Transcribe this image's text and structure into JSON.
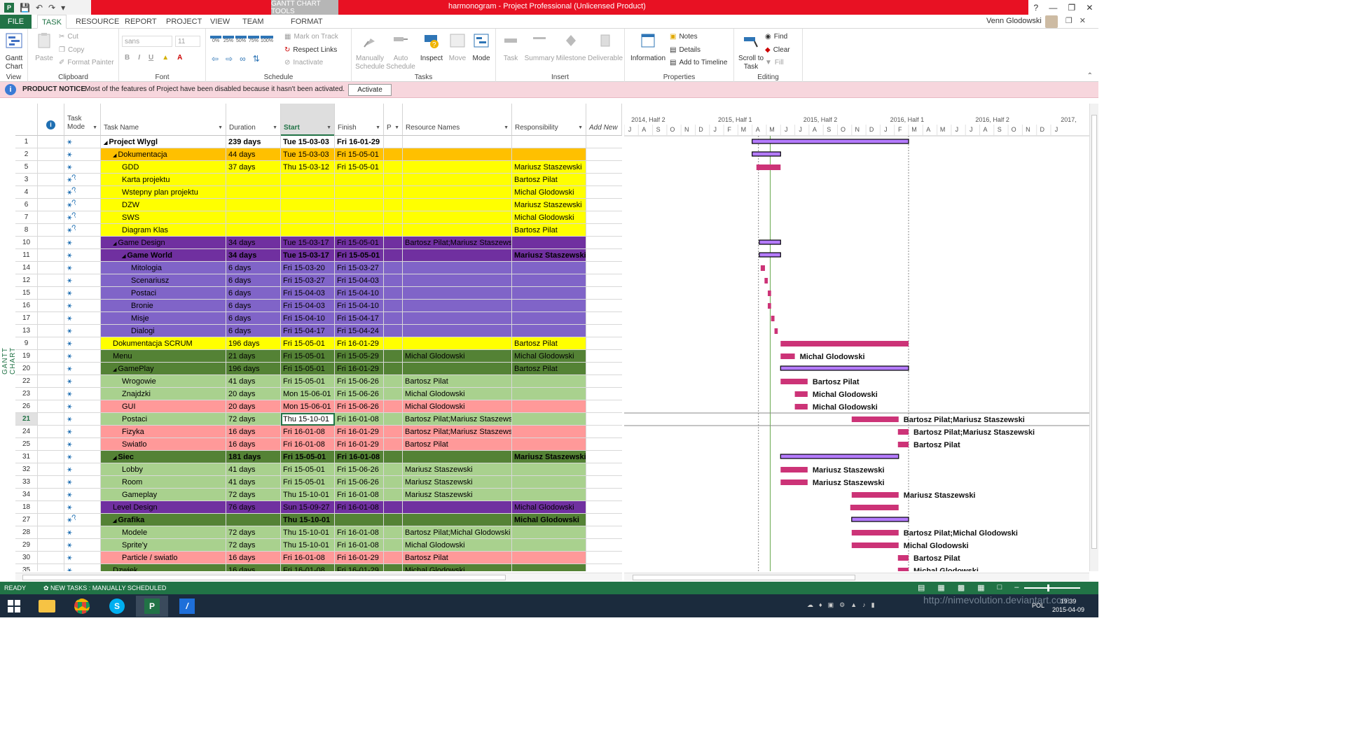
{
  "app": {
    "window_title": "harmonogram - Project Professional (Unlicensed Product)",
    "context_tab_header": "GANTT CHART TOOLS",
    "user_name": "Venn Glodowski"
  },
  "tabs": [
    "FILE",
    "TASK",
    "RESOURCE",
    "REPORT",
    "PROJECT",
    "VIEW",
    "TEAM",
    "FORMAT"
  ],
  "ribbon": {
    "view": {
      "label": "View",
      "gantt": "Gantt Chart"
    },
    "clipboard": {
      "label": "Clipboard",
      "paste": "Paste",
      "cut": "Cut",
      "copy": "Copy",
      "format_painter": "Format Painter"
    },
    "font": {
      "label": "Font",
      "family": "sans",
      "size": "11"
    },
    "schedule": {
      "label": "Schedule",
      "mark_on_track": "Mark on Track",
      "respect_links": "Respect Links",
      "inactivate": "Inactivate",
      "pct": [
        "0%",
        "25%",
        "50%",
        "75%",
        "100%"
      ]
    },
    "tasks": {
      "label": "Tasks",
      "manually": "Manually Schedule",
      "auto": "Auto Schedule",
      "inspect": "Inspect",
      "move": "Move",
      "mode": "Mode"
    },
    "insert": {
      "label": "Insert",
      "task": "Task",
      "summary": "Summary",
      "milestone": "Milestone",
      "deliverable": "Deliverable"
    },
    "properties": {
      "label": "Properties",
      "information": "Information",
      "notes": "Notes",
      "details": "Details",
      "add_to_timeline": "Add to Timeline"
    },
    "editing": {
      "label": "Editing",
      "scroll": "Scroll to Task",
      "find": "Find",
      "clear": "Clear",
      "fill": "Fill"
    }
  },
  "notice": {
    "title": "PRODUCT NOTICE",
    "text": "Most of the features of Project have been disabled because it hasn't been activated.",
    "button": "Activate"
  },
  "side_label": "GANTT CHART",
  "columns": {
    "task_mode": "Task Mode",
    "task_name": "Task Name",
    "duration": "Duration",
    "start": "Start",
    "finish": "Finish",
    "p": "P",
    "resource_names": "Resource Names",
    "responsibility": "Responsibility",
    "add_new": "Add New"
  },
  "timescale": {
    "top": [
      {
        "label": "2014, Half 2",
        "start": 0.5
      },
      {
        "label": "2015, Half 1",
        "start": 6.6
      },
      {
        "label": "2015, Half 2",
        "start": 12.6
      },
      {
        "label": "2016, Half 1",
        "start": 18.7
      },
      {
        "label": "2016, Half 2",
        "start": 24.7
      },
      {
        "label": "2017,",
        "start": 30.7
      }
    ],
    "months": [
      "J",
      "A",
      "S",
      "O",
      "N",
      "D",
      "J",
      "F",
      "M",
      "A",
      "M",
      "J",
      "J",
      "A",
      "S",
      "O",
      "N",
      "D",
      "J",
      "F",
      "M",
      "A",
      "M",
      "J",
      "J",
      "A",
      "S",
      "O",
      "N",
      "D",
      "J"
    ]
  },
  "rows": [
    {
      "id": "1",
      "mode": "manual",
      "name": "Project Wlygl",
      "dur": "239 days",
      "start": "Tue 15-03-03",
      "fin": "Fri 16-01-29",
      "res": "",
      "resp": "",
      "fill": "#ffffff",
      "text": "#000000",
      "bold": true,
      "indent": 0,
      "summary": true,
      "bar": {
        "type": "summary",
        "s": 9.0,
        "e": 20.0
      },
      "label": ""
    },
    {
      "id": "2",
      "mode": "manual",
      "name": "Dokumentacja",
      "dur": "44 days",
      "start": "Tue 15-03-03",
      "fin": "Fri 15-05-01",
      "res": "",
      "resp": "",
      "fill": "#ffc000",
      "text": "#000000",
      "bold": false,
      "indent": 1,
      "summary": true,
      "bar": {
        "type": "summary",
        "s": 9.0,
        "e": 11.0
      },
      "label": ""
    },
    {
      "id": "5",
      "mode": "manual",
      "name": "GDD",
      "dur": "37 days",
      "start": "Thu 15-03-12",
      "fin": "Fri 15-05-01",
      "res": "",
      "resp": "Mariusz Staszewski",
      "fill": "#ffff00",
      "text": "#000000",
      "bold": false,
      "indent": 2,
      "summary": false,
      "bar": {
        "type": "task",
        "s": 9.3,
        "e": 11.0
      },
      "label": ""
    },
    {
      "id": "3",
      "mode": "estimated",
      "name": "Karta projektu",
      "dur": "",
      "start": "",
      "fin": "",
      "res": "",
      "resp": "Bartosz Pilat",
      "fill": "#ffff00",
      "text": "#000000",
      "bold": false,
      "indent": 2,
      "summary": false,
      "bar": null,
      "label": ""
    },
    {
      "id": "4",
      "mode": "estimated",
      "name": "Wstepny plan projektu",
      "dur": "",
      "start": "",
      "fin": "",
      "res": "",
      "resp": "Michal Glodowski",
      "fill": "#ffff00",
      "text": "#000000",
      "bold": false,
      "indent": 2,
      "summary": false,
      "bar": null,
      "label": ""
    },
    {
      "id": "6",
      "mode": "estimated",
      "name": "DZW",
      "dur": "",
      "start": "",
      "fin": "",
      "res": "",
      "resp": "Mariusz Staszewski",
      "fill": "#ffff00",
      "text": "#000000",
      "bold": false,
      "indent": 2,
      "summary": false,
      "bar": null,
      "label": ""
    },
    {
      "id": "7",
      "mode": "estimated",
      "name": "SWS",
      "dur": "",
      "start": "",
      "fin": "",
      "res": "",
      "resp": "Michal Glodowski",
      "fill": "#ffff00",
      "text": "#000000",
      "bold": false,
      "indent": 2,
      "summary": false,
      "bar": null,
      "label": ""
    },
    {
      "id": "8",
      "mode": "estimated",
      "name": "Diagram Klas",
      "dur": "",
      "start": "",
      "fin": "",
      "res": "",
      "resp": "Bartosz Pilat",
      "fill": "#ffff00",
      "text": "#000000",
      "bold": false,
      "indent": 2,
      "summary": false,
      "bar": null,
      "label": ""
    },
    {
      "id": "10",
      "mode": "manual",
      "name": "Game Design",
      "dur": "34 days",
      "start": "Tue 15-03-17",
      "fin": "Fri 15-05-01",
      "res": "Bartosz Pilat;Mariusz Staszewski",
      "resp": "",
      "fill": "#7030a0",
      "text": "#000000",
      "bold": false,
      "indent": 1,
      "summary": true,
      "bar": {
        "type": "summary",
        "s": 9.5,
        "e": 11.0
      },
      "label": ""
    },
    {
      "id": "11",
      "mode": "manual",
      "name": "Game World",
      "dur": "34 days",
      "start": "Tue 15-03-17",
      "fin": "Fri 15-05-01",
      "res": "",
      "resp": "Mariusz Staszewski",
      "fill": "#7030a0",
      "text": "#000000",
      "bold": true,
      "indent": 2,
      "summary": true,
      "bar": {
        "type": "summary",
        "s": 9.5,
        "e": 11.0
      },
      "label": ""
    },
    {
      "id": "14",
      "mode": "manual",
      "name": "Mitologia",
      "dur": "6 days",
      "start": "Fri 15-03-20",
      "fin": "Fri 15-03-27",
      "res": "",
      "resp": "",
      "fill": "#8064c8",
      "text": "#000000",
      "bold": false,
      "indent": 3,
      "summary": false,
      "bar": {
        "type": "task",
        "s": 9.6,
        "e": 9.9
      },
      "label": ""
    },
    {
      "id": "12",
      "mode": "manual",
      "name": "Scenariusz",
      "dur": "6 days",
      "start": "Fri 15-03-27",
      "fin": "Fri 15-04-03",
      "res": "",
      "resp": "",
      "fill": "#8064c8",
      "text": "#000000",
      "bold": false,
      "indent": 3,
      "summary": false,
      "bar": {
        "type": "task",
        "s": 9.87,
        "e": 10.1
      },
      "label": ""
    },
    {
      "id": "15",
      "mode": "manual",
      "name": "Postaci",
      "dur": "6 days",
      "start": "Fri 15-04-03",
      "fin": "Fri 15-04-10",
      "res": "",
      "resp": "",
      "fill": "#8064c8",
      "text": "#000000",
      "bold": false,
      "indent": 3,
      "summary": false,
      "bar": {
        "type": "task",
        "s": 10.1,
        "e": 10.33
      },
      "label": ""
    },
    {
      "id": "16",
      "mode": "manual",
      "name": "Bronie",
      "dur": "6 days",
      "start": "Fri 15-04-03",
      "fin": "Fri 15-04-10",
      "res": "",
      "resp": "",
      "fill": "#8064c8",
      "text": "#000000",
      "bold": false,
      "indent": 3,
      "summary": false,
      "bar": {
        "type": "task",
        "s": 10.1,
        "e": 10.33
      },
      "label": ""
    },
    {
      "id": "17",
      "mode": "manual",
      "name": "Misje",
      "dur": "6 days",
      "start": "Fri 15-04-10",
      "fin": "Fri 15-04-17",
      "res": "",
      "resp": "",
      "fill": "#8064c8",
      "text": "#000000",
      "bold": false,
      "indent": 3,
      "summary": false,
      "bar": {
        "type": "task",
        "s": 10.33,
        "e": 10.57
      },
      "label": ""
    },
    {
      "id": "13",
      "mode": "manual",
      "name": "Dialogi",
      "dur": "6 days",
      "start": "Fri 15-04-17",
      "fin": "Fri 15-04-24",
      "res": "",
      "resp": "",
      "fill": "#8064c8",
      "text": "#000000",
      "bold": false,
      "indent": 3,
      "summary": false,
      "bar": {
        "type": "task",
        "s": 10.57,
        "e": 10.8
      },
      "label": ""
    },
    {
      "id": "9",
      "mode": "manual",
      "name": "Dokumentacja SCRUM",
      "dur": "196 days",
      "start": "Fri 15-05-01",
      "fin": "Fri 16-01-29",
      "res": "",
      "resp": "Bartosz Pilat",
      "fill": "#ffff00",
      "text": "#000000",
      "bold": false,
      "indent": 1,
      "summary": false,
      "bar": {
        "type": "task",
        "s": 11.0,
        "e": 20.0
      },
      "label": ""
    },
    {
      "id": "19",
      "mode": "manual",
      "name": "Menu",
      "dur": "21 days",
      "start": "Fri 15-05-01",
      "fin": "Fri 15-05-29",
      "res": "Michal Glodowski",
      "resp": "Michal Glodowski",
      "fill": "#548235",
      "text": "#000000",
      "bold": false,
      "indent": 1,
      "summary": false,
      "bar": {
        "type": "task",
        "s": 11.0,
        "e": 12.0
      },
      "label": "Michal Glodowski"
    },
    {
      "id": "20",
      "mode": "manual",
      "name": "GamePlay",
      "dur": "196 days",
      "start": "Fri 15-05-01",
      "fin": "Fri 16-01-29",
      "res": "",
      "resp": "Bartosz Pilat",
      "fill": "#548235",
      "text": "#000000",
      "bold": false,
      "indent": 1,
      "summary": true,
      "bar": {
        "type": "summary",
        "s": 11.0,
        "e": 20.0
      },
      "label": ""
    },
    {
      "id": "22",
      "mode": "manual",
      "name": "Wrogowie",
      "dur": "41 days",
      "start": "Fri 15-05-01",
      "fin": "Fri 15-06-26",
      "res": "Bartosz Pilat",
      "resp": "",
      "fill": "#a9d18e",
      "text": "#000000",
      "bold": false,
      "indent": 2,
      "summary": false,
      "bar": {
        "type": "task",
        "s": 11.0,
        "e": 12.9
      },
      "label": "Bartosz Pilat"
    },
    {
      "id": "23",
      "mode": "manual",
      "name": "Znajdzki",
      "dur": "20 days",
      "start": "Mon 15-06-01",
      "fin": "Fri 15-06-26",
      "res": "Michal Glodowski",
      "resp": "",
      "fill": "#a9d18e",
      "text": "#000000",
      "bold": false,
      "indent": 2,
      "summary": false,
      "bar": {
        "type": "task",
        "s": 12.0,
        "e": 12.9
      },
      "label": "Michal Glodowski"
    },
    {
      "id": "26",
      "mode": "manual",
      "name": "GUI",
      "dur": "20 days",
      "start": "Mon 15-06-01",
      "fin": "Fri 15-06-26",
      "res": "Michal Glodowski",
      "resp": "",
      "fill": "#ff9999",
      "text": "#000000",
      "bold": false,
      "indent": 2,
      "summary": false,
      "bar": {
        "type": "task",
        "s": 12.0,
        "e": 12.9
      },
      "label": "Michal Glodowski"
    },
    {
      "id": "21",
      "mode": "manual",
      "name": "Postaci",
      "dur": "72 days",
      "start": "Thu 15-10-01",
      "fin": "Fri 16-01-08",
      "res": "Bartosz Pilat;Mariusz Staszewski",
      "resp": "",
      "fill": "#a9d18e",
      "text": "#000000",
      "bold": false,
      "indent": 2,
      "summary": false,
      "bar": {
        "type": "task",
        "s": 16.0,
        "e": 19.3
      },
      "label": "Bartosz Pilat;Mariusz Staszewski",
      "selected": true
    },
    {
      "id": "24",
      "mode": "manual",
      "name": "Fizyka",
      "dur": "16 days",
      "start": "Fri 16-01-08",
      "fin": "Fri 16-01-29",
      "res": "Bartosz Pilat;Mariusz Staszewski",
      "resp": "",
      "fill": "#ff9999",
      "text": "#000000",
      "bold": false,
      "indent": 2,
      "summary": false,
      "bar": {
        "type": "task",
        "s": 19.25,
        "e": 20.0
      },
      "label": "Bartosz Pilat;Mariusz Staszewski"
    },
    {
      "id": "25",
      "mode": "manual",
      "name": "Swiatlo",
      "dur": "16 days",
      "start": "Fri 16-01-08",
      "fin": "Fri 16-01-29",
      "res": "Bartosz Pilat",
      "resp": "",
      "fill": "#ff9999",
      "text": "#000000",
      "bold": false,
      "indent": 2,
      "summary": false,
      "bar": {
        "type": "task",
        "s": 19.25,
        "e": 20.0
      },
      "label": "Bartosz Pilat"
    },
    {
      "id": "31",
      "mode": "manual",
      "name": "Siec",
      "dur": "181 days",
      "start": "Fri 15-05-01",
      "fin": "Fri 16-01-08",
      "res": "",
      "resp": "Mariusz Staszewski",
      "fill": "#548235",
      "text": "#000000",
      "bold": true,
      "indent": 1,
      "summary": true,
      "bar": {
        "type": "summary",
        "s": 11.0,
        "e": 19.3
      },
      "label": ""
    },
    {
      "id": "32",
      "mode": "manual",
      "name": "Lobby",
      "dur": "41 days",
      "start": "Fri 15-05-01",
      "fin": "Fri 15-06-26",
      "res": "Mariusz Staszewski",
      "resp": "",
      "fill": "#a9d18e",
      "text": "#000000",
      "bold": false,
      "indent": 2,
      "summary": false,
      "bar": {
        "type": "task",
        "s": 11.0,
        "e": 12.9
      },
      "label": "Mariusz Staszewski"
    },
    {
      "id": "33",
      "mode": "manual",
      "name": "Room",
      "dur": "41 days",
      "start": "Fri 15-05-01",
      "fin": "Fri 15-06-26",
      "res": "Mariusz Staszewski",
      "resp": "",
      "fill": "#a9d18e",
      "text": "#000000",
      "bold": false,
      "indent": 2,
      "summary": false,
      "bar": {
        "type": "task",
        "s": 11.0,
        "e": 12.9
      },
      "label": "Mariusz Staszewski"
    },
    {
      "id": "34",
      "mode": "manual",
      "name": "Gameplay",
      "dur": "72 days",
      "start": "Thu 15-10-01",
      "fin": "Fri 16-01-08",
      "res": "Mariusz Staszewski",
      "resp": "",
      "fill": "#a9d18e",
      "text": "#000000",
      "bold": false,
      "indent": 2,
      "summary": false,
      "bar": {
        "type": "task",
        "s": 16.0,
        "e": 19.3
      },
      "label": "Mariusz Staszewski"
    },
    {
      "id": "18",
      "mode": "manual",
      "name": "Level Design",
      "dur": "76 days",
      "start": "Sun 15-09-27",
      "fin": "Fri 16-01-08",
      "res": "",
      "resp": "Michal Glodowski",
      "fill": "#7030a0",
      "text": "#000000",
      "bold": false,
      "indent": 1,
      "summary": false,
      "bar": {
        "type": "task",
        "s": 15.9,
        "e": 19.3
      },
      "label": ""
    },
    {
      "id": "27",
      "mode": "estimated",
      "name": "Grafika",
      "dur": "",
      "start": "Thu 15-10-01",
      "fin": "",
      "res": "",
      "resp": "Michal Glodowski",
      "fill": "#548235",
      "text": "#000000",
      "bold": true,
      "indent": 1,
      "summary": true,
      "bar": {
        "type": "summary",
        "s": 16.0,
        "e": 20.0
      },
      "label": ""
    },
    {
      "id": "28",
      "mode": "manual",
      "name": "Modele",
      "dur": "72 days",
      "start": "Thu 15-10-01",
      "fin": "Fri 16-01-08",
      "res": "Bartosz Pilat;Michal Glodowski",
      "resp": "",
      "fill": "#a9d18e",
      "text": "#000000",
      "bold": false,
      "indent": 2,
      "summary": false,
      "bar": {
        "type": "task",
        "s": 16.0,
        "e": 19.3
      },
      "label": "Bartosz Pilat;Michal Glodowski"
    },
    {
      "id": "29",
      "mode": "manual",
      "name": "Sprite'y",
      "dur": "72 days",
      "start": "Thu 15-10-01",
      "fin": "Fri 16-01-08",
      "res": "Michal Glodowski",
      "resp": "",
      "fill": "#a9d18e",
      "text": "#000000",
      "bold": false,
      "indent": 2,
      "summary": false,
      "bar": {
        "type": "task",
        "s": 16.0,
        "e": 19.3
      },
      "label": "Michal Glodowski"
    },
    {
      "id": "30",
      "mode": "manual",
      "name": "Particle / swiatlo",
      "dur": "16 days",
      "start": "Fri 16-01-08",
      "fin": "Fri 16-01-29",
      "res": "Bartosz Pilat",
      "resp": "",
      "fill": "#ff9999",
      "text": "#000000",
      "bold": false,
      "indent": 2,
      "summary": false,
      "bar": {
        "type": "task",
        "s": 19.25,
        "e": 20.0
      },
      "label": "Bartosz Pilat"
    },
    {
      "id": "35",
      "mode": "manual",
      "name": "Dzwiek",
      "dur": "16 days",
      "start": "Fri 16-01-08",
      "fin": "Fri 16-01-29",
      "res": "Michal Glodowski",
      "resp": "",
      "fill": "#548235",
      "text": "#000000",
      "bold": false,
      "indent": 1,
      "summary": false,
      "bar": {
        "type": "task",
        "s": 19.25,
        "e": 20.0
      },
      "label": "Michal Glodowski"
    }
  ],
  "status": {
    "ready": "READY",
    "new_tasks": "NEW TASKS : MANUALLY SCHEDULED"
  },
  "taskbar": {
    "lang": "POL",
    "time": "19:39",
    "date": "2015-04-09"
  },
  "watermark": "http://nimevolution.deviantart.com",
  "colors": {
    "accent": "#217346",
    "title": "#e81123",
    "task_bar": "#cc3377",
    "summary_bar": "#b57bff"
  }
}
